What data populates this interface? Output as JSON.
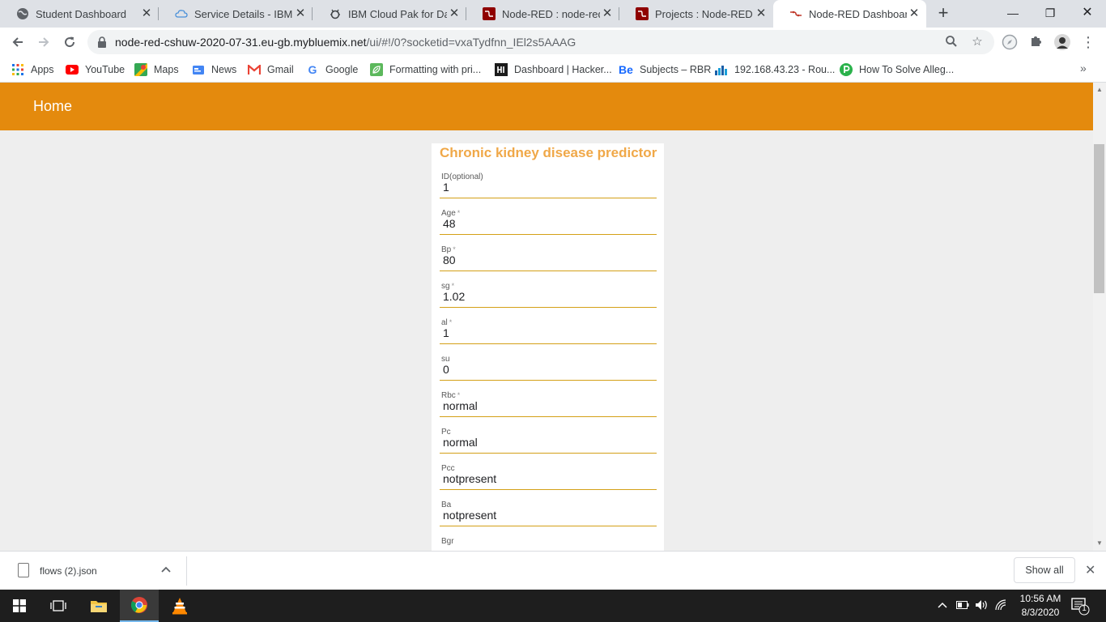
{
  "browser": {
    "tabs": [
      {
        "title": "Student Dashboard",
        "icon": "globe-icon",
        "active": false
      },
      {
        "title": "Service Details - IBM Cl",
        "icon": "cloud-icon",
        "active": false
      },
      {
        "title": "IBM Cloud Pak for Data",
        "icon": "ibm-bee-icon",
        "active": false
      },
      {
        "title": "Node-RED : node-red-c",
        "icon": "node-red-icon",
        "active": false
      },
      {
        "title": "Projects : Node-RED",
        "icon": "node-red-icon",
        "active": false
      },
      {
        "title": "Node-RED Dashboard",
        "icon": "node-red-dashboard-icon",
        "active": true
      }
    ],
    "url_host": "node-red-cshuw-2020-07-31.eu-gb.mybluemix.net",
    "url_path": "/ui/#!/0?socketid=vxaTydfnn_IEl2s5AAAG",
    "bookmarks": [
      {
        "label": "Apps",
        "icon": "apps-grid-icon"
      },
      {
        "label": "YouTube",
        "icon": "youtube-icon"
      },
      {
        "label": "Maps",
        "icon": "maps-icon"
      },
      {
        "label": "News",
        "icon": "news-icon"
      },
      {
        "label": "Gmail",
        "icon": "gmail-icon"
      },
      {
        "label": "Google",
        "icon": "google-icon"
      },
      {
        "label": "Formatting with pri...",
        "icon": "leaf-icon"
      },
      {
        "label": "Dashboard | Hacker...",
        "icon": "hackerearth-icon"
      },
      {
        "label": "Subjects – RBR",
        "icon": "behance-icon"
      },
      {
        "label": "192.168.43.23 - Rou...",
        "icon": "router-chart-icon"
      },
      {
        "label": "How To Solve Alleg...",
        "icon": "p-badge-icon"
      }
    ]
  },
  "dashboard": {
    "title": "Home",
    "form_title": "Chronic kidney disease predictor",
    "fields": [
      {
        "label": "ID(optional)",
        "required": false,
        "value": "1"
      },
      {
        "label": "Age",
        "required": true,
        "value": "48"
      },
      {
        "label": "Bp",
        "required": true,
        "value": "80"
      },
      {
        "label": "sg",
        "required": true,
        "value": "1.02"
      },
      {
        "label": "al",
        "required": true,
        "value": "1"
      },
      {
        "label": "su",
        "required": false,
        "value": "0"
      },
      {
        "label": "Rbc",
        "required": true,
        "value": "normal"
      },
      {
        "label": "Pc",
        "required": false,
        "value": "normal"
      },
      {
        "label": "Pcc",
        "required": false,
        "value": "notpresent"
      },
      {
        "label": "Ba",
        "required": false,
        "value": "notpresent"
      },
      {
        "label": "Bgr",
        "required": false,
        "value": ""
      }
    ],
    "required_mark": "*",
    "colors": {
      "header": "#e48a0d",
      "title": "#f0a848",
      "underline": "#d4a017"
    }
  },
  "downloads": {
    "filename": "flows (2).json",
    "show_all": "Show all"
  },
  "taskbar": {
    "time": "10:56 AM",
    "date": "8/3/2020",
    "notification_count": "1"
  }
}
